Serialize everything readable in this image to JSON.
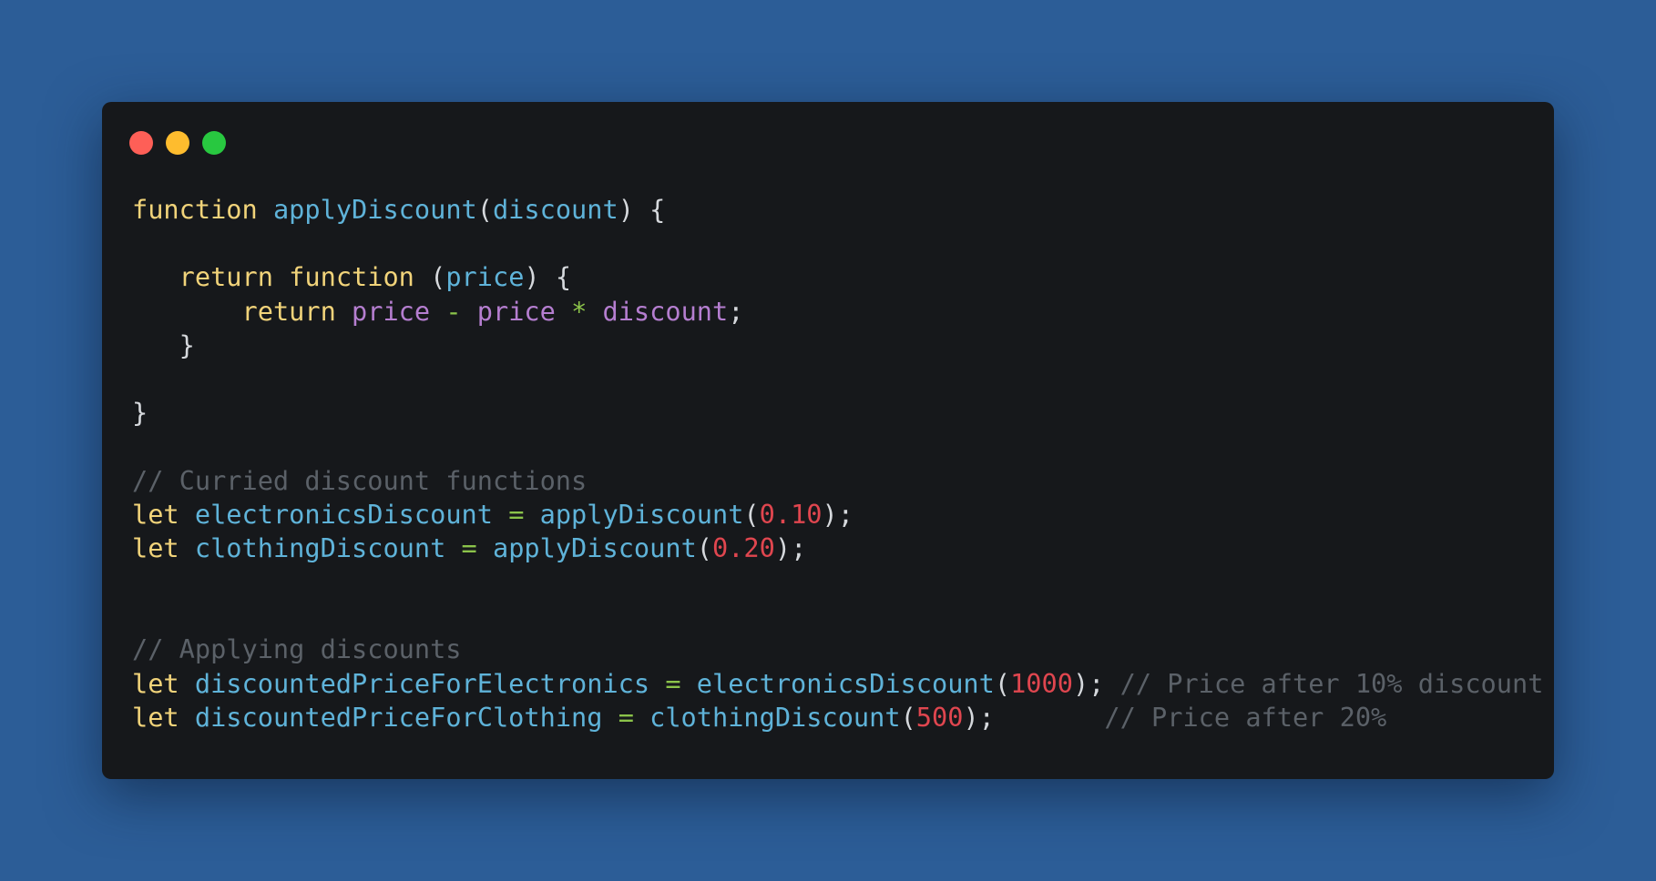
{
  "window": {
    "traffic_lights": [
      {
        "name": "close",
        "color": "#fe5f57"
      },
      {
        "name": "minimize",
        "color": "#febc2e"
      },
      {
        "name": "zoom",
        "color": "#28c840"
      }
    ]
  },
  "code": {
    "language": "javascript",
    "lines": [
      [
        {
          "t": "function",
          "k": "keyword"
        },
        {
          "t": " ",
          "k": "space"
        },
        {
          "t": "applyDiscount",
          "k": "func"
        },
        {
          "t": "(",
          "k": "punct"
        },
        {
          "t": "discount",
          "k": "ident"
        },
        {
          "t": ") {",
          "k": "punct"
        }
      ],
      [],
      [
        {
          "t": "   ",
          "k": "space"
        },
        {
          "t": "return",
          "k": "keyword"
        },
        {
          "t": " ",
          "k": "space"
        },
        {
          "t": "function",
          "k": "keyword"
        },
        {
          "t": " (",
          "k": "punct"
        },
        {
          "t": "price",
          "k": "ident"
        },
        {
          "t": ") {",
          "k": "punct"
        }
      ],
      [
        {
          "t": "       ",
          "k": "space"
        },
        {
          "t": "return",
          "k": "keyword"
        },
        {
          "t": " ",
          "k": "space"
        },
        {
          "t": "price",
          "k": "param"
        },
        {
          "t": " ",
          "k": "space"
        },
        {
          "t": "-",
          "k": "op"
        },
        {
          "t": " ",
          "k": "space"
        },
        {
          "t": "price",
          "k": "param"
        },
        {
          "t": " ",
          "k": "space"
        },
        {
          "t": "*",
          "k": "op"
        },
        {
          "t": " ",
          "k": "space"
        },
        {
          "t": "discount",
          "k": "param"
        },
        {
          "t": ";",
          "k": "punct"
        }
      ],
      [
        {
          "t": "   ",
          "k": "space"
        },
        {
          "t": "}",
          "k": "punct"
        }
      ],
      [],
      [
        {
          "t": "}",
          "k": "punct"
        }
      ],
      [],
      [
        {
          "t": "// Curried discount functions",
          "k": "comment"
        }
      ],
      [
        {
          "t": "let",
          "k": "keyword"
        },
        {
          "t": " ",
          "k": "space"
        },
        {
          "t": "electronicsDiscount",
          "k": "ident"
        },
        {
          "t": " ",
          "k": "space"
        },
        {
          "t": "=",
          "k": "op"
        },
        {
          "t": " ",
          "k": "space"
        },
        {
          "t": "applyDiscount",
          "k": "func"
        },
        {
          "t": "(",
          "k": "punct"
        },
        {
          "t": "0.10",
          "k": "num"
        },
        {
          "t": ");",
          "k": "punct"
        }
      ],
      [
        {
          "t": "let",
          "k": "keyword"
        },
        {
          "t": " ",
          "k": "space"
        },
        {
          "t": "clothingDiscount",
          "k": "ident"
        },
        {
          "t": " ",
          "k": "space"
        },
        {
          "t": "=",
          "k": "op"
        },
        {
          "t": " ",
          "k": "space"
        },
        {
          "t": "applyDiscount",
          "k": "func"
        },
        {
          "t": "(",
          "k": "punct"
        },
        {
          "t": "0.20",
          "k": "num"
        },
        {
          "t": ");",
          "k": "punct"
        }
      ],
      [],
      [],
      [
        {
          "t": "// Applying discounts",
          "k": "comment"
        }
      ],
      [
        {
          "t": "let",
          "k": "keyword"
        },
        {
          "t": " ",
          "k": "space"
        },
        {
          "t": "discountedPriceForElectronics",
          "k": "ident"
        },
        {
          "t": " ",
          "k": "space"
        },
        {
          "t": "=",
          "k": "op"
        },
        {
          "t": " ",
          "k": "space"
        },
        {
          "t": "electronicsDiscount",
          "k": "func"
        },
        {
          "t": "(",
          "k": "punct"
        },
        {
          "t": "1000",
          "k": "num"
        },
        {
          "t": "); ",
          "k": "punct"
        },
        {
          "t": "// Price after 10% discount",
          "k": "comment"
        }
      ],
      [
        {
          "t": "let",
          "k": "keyword"
        },
        {
          "t": " ",
          "k": "space"
        },
        {
          "t": "discountedPriceForClothing",
          "k": "ident"
        },
        {
          "t": " ",
          "k": "space"
        },
        {
          "t": "=",
          "k": "op"
        },
        {
          "t": " ",
          "k": "space"
        },
        {
          "t": "clothingDiscount",
          "k": "func"
        },
        {
          "t": "(",
          "k": "punct"
        },
        {
          "t": "500",
          "k": "num"
        },
        {
          "t": ");       ",
          "k": "punct"
        },
        {
          "t": "// Price after 20%",
          "k": "comment"
        }
      ]
    ]
  }
}
